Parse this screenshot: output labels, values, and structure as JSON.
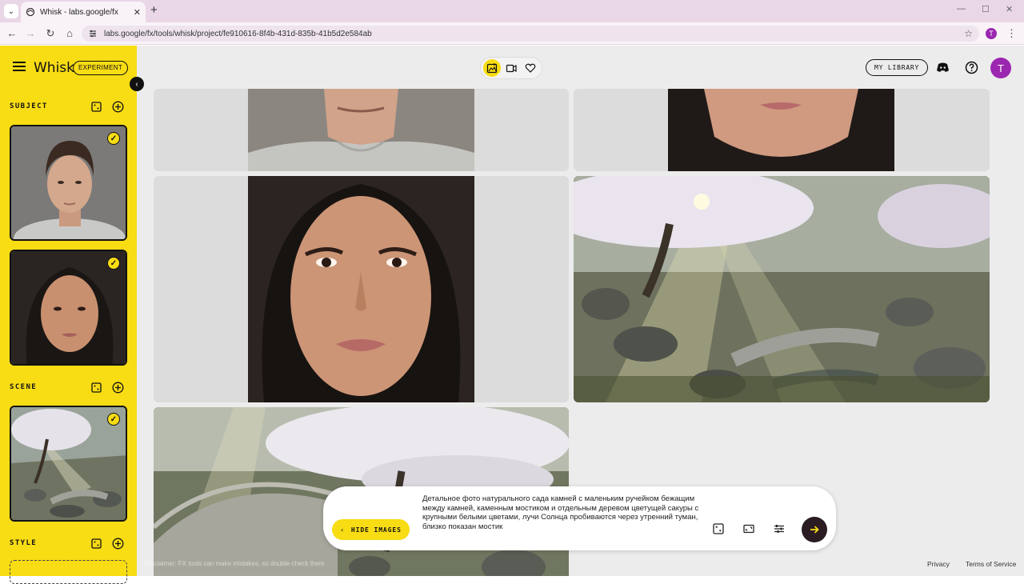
{
  "browser": {
    "tab_title": "Whisk - labs.google/fx",
    "url": "labs.google/fx/tools/whisk/project/fe910616-8f4b-431d-835b-41b5d2e584ab",
    "profile_initial": "T"
  },
  "sidebar": {
    "brand": "Whisk",
    "badge": "EXPERIMENT",
    "sections": {
      "subject": "SUBJECT",
      "scene": "SCENE",
      "style": "STYLE"
    }
  },
  "topbar": {
    "library_button": "MY LIBRARY",
    "avatar_initial": "T"
  },
  "prompt": {
    "hide_images_label": "HIDE IMAGES",
    "text": "Детальное фото натурального сада камней с маленьким ручейком бежащим между камней, каменным мостиком и отдельным деревом цветущей сакуры с крупными белыми цветами, лучи Солнца пробиваются через утренний туман, близко показан мостик"
  },
  "footer": {
    "disclaimer": "Disclaimer: FX tools can make mistakes, so double-check them",
    "privacy": "Privacy",
    "terms": "Terms of Service"
  },
  "colors": {
    "accent_yellow": "#f8dc14",
    "avatar_purple": "#9b27b0",
    "send_button": "#2b1b22"
  },
  "icons": [
    "menu-icon",
    "chevron-left-icon",
    "dice-icon",
    "add-circle-icon",
    "check-icon",
    "image-mode-icon",
    "video-mode-icon",
    "heart-icon",
    "discord-icon",
    "help-icon",
    "aspect-ratio-icon",
    "settings-sliders-icon",
    "arrow-right-icon"
  ]
}
